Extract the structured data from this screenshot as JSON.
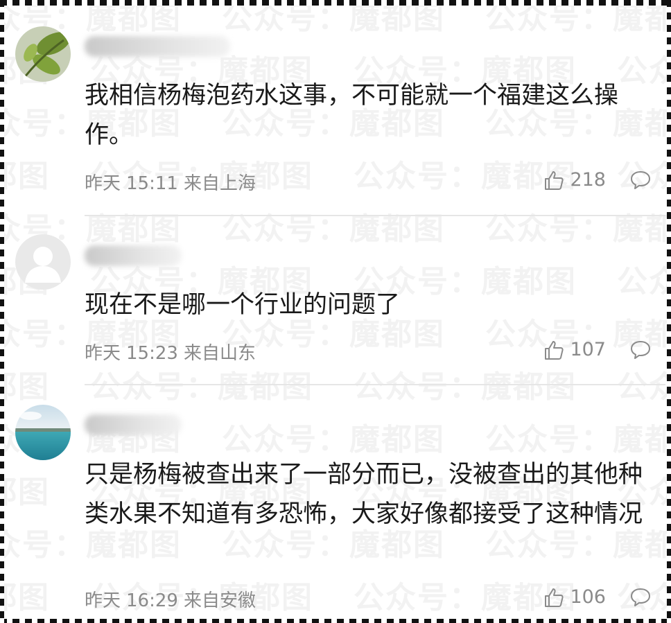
{
  "watermark": "公众号：魔都图",
  "comments": [
    {
      "content": "我相信杨梅泡药水这事，不可能就一个福建这么操作。",
      "date": "昨天",
      "time": "15:11",
      "location": "来自上海",
      "likes": "218",
      "avatar_icon": "plant-photo-avatar"
    },
    {
      "content": "现在不是哪一个行业的问题了",
      "date": "昨天",
      "time": "15:23",
      "location": "来自山东",
      "likes": "107",
      "avatar_icon": "default-user-avatar"
    },
    {
      "content": "只是杨梅被查出来了一部分而已，没被查出的其他种类水果不知道有多恐怖，大家好像都接受了这种情况",
      "date": "昨天",
      "time": "16:29",
      "location": "来自安徽",
      "likes": "106",
      "avatar_icon": "sea-photo-avatar"
    }
  ],
  "colors": {
    "meta": "#8a8a8a",
    "text": "#1a1a1a",
    "divider": "#e6e6e6"
  }
}
